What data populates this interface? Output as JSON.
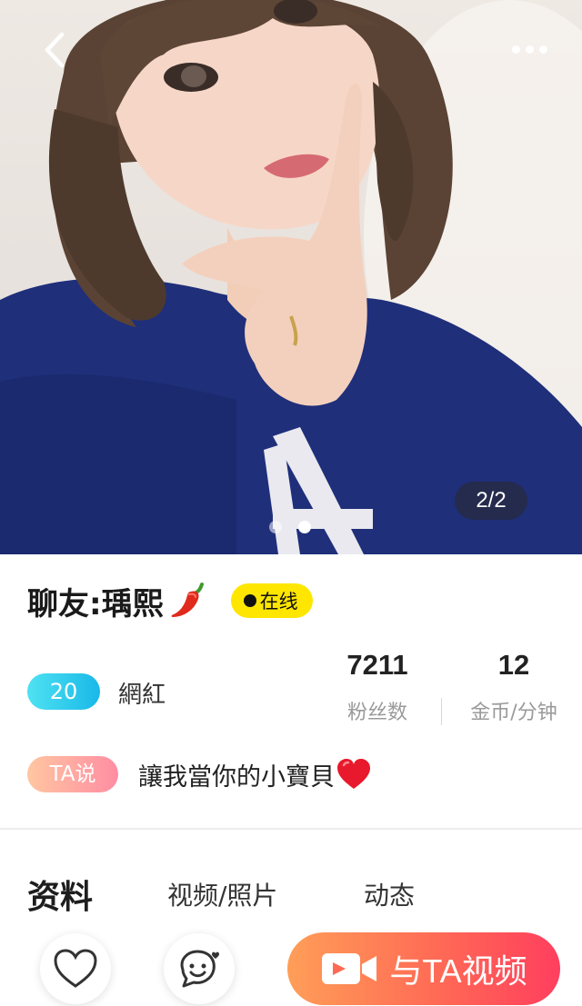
{
  "photo": {
    "counter": "2/2",
    "page_count": 2,
    "current_page": 2
  },
  "profile": {
    "name": "聊友:瑀熙",
    "status": "在线",
    "level": "20",
    "level_title": "網紅",
    "fans_count": "7211",
    "fans_label": "粉丝数",
    "rate": "12",
    "rate_label": "金币/分钟",
    "ta_label": "TA说",
    "ta_text": "讓我當你的小寶貝"
  },
  "tabs": [
    {
      "label": "资料",
      "active": true
    },
    {
      "label": "视频/照片",
      "active": false
    },
    {
      "label": "动态",
      "active": false
    }
  ],
  "actions": {
    "video_call_label": "与TA视频"
  },
  "colors": {
    "online_badge": "#ffe600",
    "level_badge": "#19b8e8",
    "ta_badge": "#ff8da2",
    "cta_start": "#ff9e58",
    "cta_end": "#ff3e5e"
  },
  "icons": {
    "back": "chevron-left-icon",
    "more": "more-dots-icon",
    "like": "heart-icon",
    "chat": "chat-face-icon",
    "video": "video-camera-icon",
    "name_emoji": "chili-pepper-icon",
    "ta_emoji": "red-heart-icon"
  }
}
